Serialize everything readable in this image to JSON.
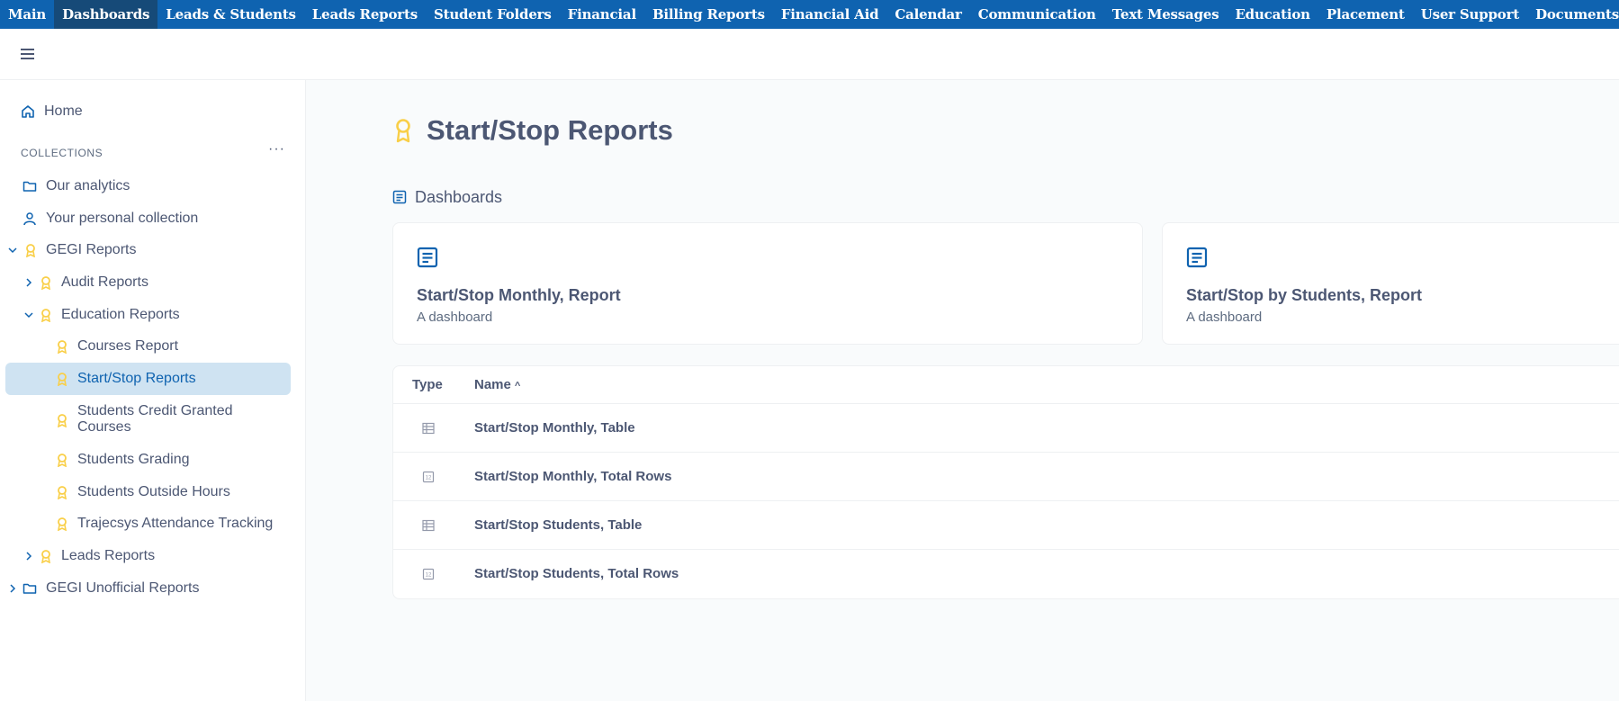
{
  "topnav": {
    "items": [
      {
        "label": "Main"
      },
      {
        "label": "Dashboards"
      },
      {
        "label": "Leads & Students"
      },
      {
        "label": "Leads Reports"
      },
      {
        "label": "Student Folders"
      },
      {
        "label": "Financial"
      },
      {
        "label": "Billing Reports"
      },
      {
        "label": "Financial Aid"
      },
      {
        "label": "Calendar"
      },
      {
        "label": "Communication"
      },
      {
        "label": "Text Messages"
      },
      {
        "label": "Education"
      },
      {
        "label": "Placement"
      },
      {
        "label": "User Support"
      },
      {
        "label": "Documents"
      }
    ],
    "active": "Dashboards"
  },
  "appbar": {
    "menu_icon": "hamburger-icon"
  },
  "sidebar": {
    "home": {
      "label": "Home",
      "icon": "home-icon"
    },
    "collections_header": "COLLECTIONS",
    "more_label": "···",
    "items": [
      {
        "label": "Our analytics",
        "icon": "folder-icon"
      },
      {
        "label": "Your personal collection",
        "icon": "person-icon"
      },
      {
        "label": "GEGI Reports",
        "icon": "badge-icon",
        "expanded": true
      },
      {
        "label": "Audit Reports",
        "icon": "badge-icon",
        "expanded": false
      },
      {
        "label": "Education Reports",
        "icon": "badge-icon",
        "expanded": true
      },
      {
        "label": "Courses Report",
        "icon": "badge-icon"
      },
      {
        "label": "Start/Stop Reports",
        "icon": "badge-icon",
        "selected": true
      },
      {
        "label": "Students Credit Granted Courses",
        "icon": "badge-icon"
      },
      {
        "label": "Students Grading",
        "icon": "badge-icon"
      },
      {
        "label": "Students Outside Hours",
        "icon": "badge-icon"
      },
      {
        "label": "Trajecsys Attendance Tracking",
        "icon": "badge-icon"
      },
      {
        "label": "Leads Reports",
        "icon": "badge-icon",
        "expanded": false
      },
      {
        "label": "GEGI Unofficial Reports",
        "icon": "folder-icon",
        "expanded": false
      }
    ]
  },
  "main": {
    "title": "Start/Stop Reports",
    "section_title": "Dashboards",
    "cards": [
      {
        "title": "Start/Stop Monthly, Report",
        "desc": "A dashboard"
      },
      {
        "title": "Start/Stop by Students, Report",
        "desc": "A dashboard"
      }
    ],
    "table": {
      "col_type": "Type",
      "col_name": "Name",
      "sort_indicator": "^",
      "rows": [
        {
          "name": "Start/Stop Monthly, Table",
          "type_icon": "table-icon"
        },
        {
          "name": "Start/Stop Monthly, Total Rows",
          "type_icon": "number-icon"
        },
        {
          "name": "Start/Stop Students, Table",
          "type_icon": "table-icon"
        },
        {
          "name": "Start/Stop Students, Total Rows",
          "type_icon": "number-icon"
        }
      ]
    }
  },
  "colors": {
    "nav_bg": "#0f63b0",
    "nav_active": "#164a78",
    "badge_yellow": "#f9cf48",
    "brand_blue": "#0f63b0",
    "selected_bg": "#cfe3f2"
  }
}
